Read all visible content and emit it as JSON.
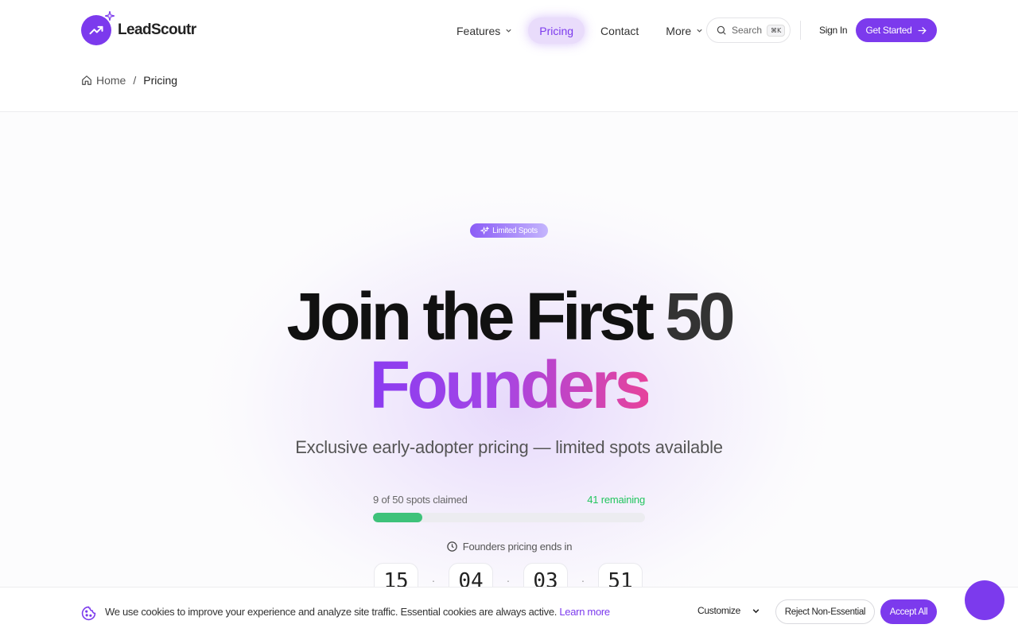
{
  "brand": {
    "name": "LeadScoutr",
    "accent": "#7c3aed"
  },
  "nav": {
    "features": "Features",
    "pricing": "Pricing",
    "contact": "Contact",
    "more": "More"
  },
  "search": {
    "label": "Search",
    "shortcut": "⌘K"
  },
  "header": {
    "sign_in": "Sign In",
    "get_started": "Get Started"
  },
  "breadcrumb": {
    "home": "Home",
    "separator": "/",
    "current": "Pricing"
  },
  "hero": {
    "badge": "Limited Spots",
    "title_line1_a": "Join the First ",
    "title_line1_b": "50",
    "title_line2": "Founders",
    "subtitle": "Exclusive early-adopter pricing — limited spots available"
  },
  "spots": {
    "claimed_text": "9 of 50 spots claimed",
    "remaining_text": "41 remaining",
    "claimed": 9,
    "total": 50,
    "fill_color": "#3ec27a"
  },
  "countdown": {
    "label": "Founders pricing ends in",
    "values": [
      "15",
      "04",
      "03",
      "51"
    ]
  },
  "cookie": {
    "message": "We use cookies to improve your experience and analyze site traffic. Essential cookies are always active.",
    "learn_more": "Learn more",
    "customize": "Customize",
    "reject": "Reject Non-Essential",
    "accept": "Accept All"
  }
}
